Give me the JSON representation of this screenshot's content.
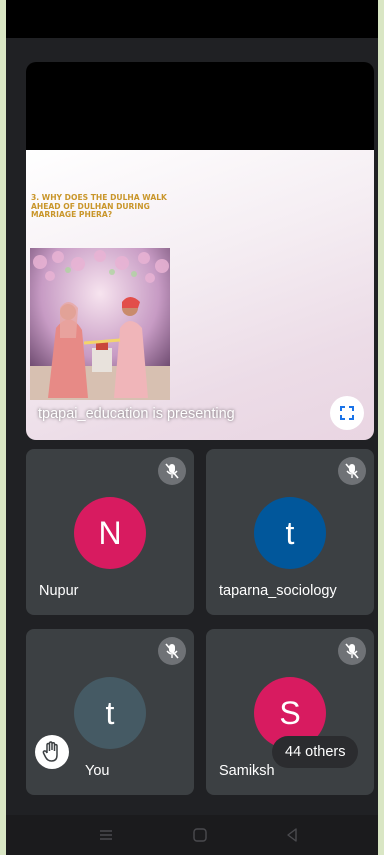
{
  "presentation": {
    "slide_title": "3. WHY DOES THE DULHA WALK\nAHEAD OF DULHAN DURING\nMARRIAGE PHERA?",
    "presenter_label": "tpapai_education is presenting"
  },
  "participants": [
    {
      "name": "Nupur",
      "initial": "N",
      "avatar_color": "#d81b60"
    },
    {
      "name": "taparna_sociology",
      "initial": "t",
      "avatar_color": "#01579b"
    },
    {
      "name": "You",
      "initial": "t",
      "avatar_color": "#455a64"
    },
    {
      "name": "Samiksh",
      "initial": "S",
      "avatar_color": "#d81b60"
    }
  ],
  "others_count_label": "44 others",
  "colors": {
    "tile": "#3c4043",
    "background": "#202124",
    "accent_title": "#c9962a"
  },
  "icons": {
    "fullscreen": "fullscreen-icon",
    "mic": "mic-off-icon",
    "hand": "raise-hand-icon"
  }
}
